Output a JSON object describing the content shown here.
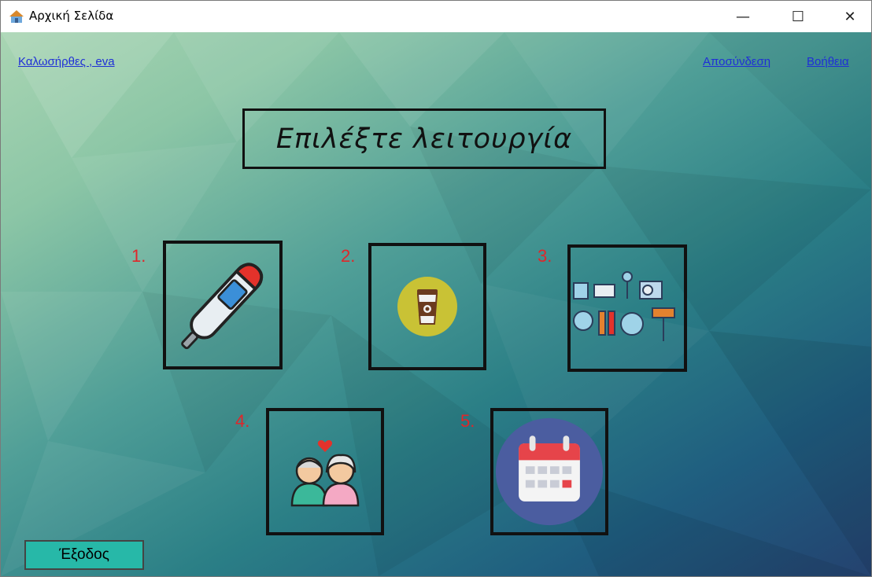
{
  "window": {
    "title": "Αρχική Σελίδα",
    "minimize_glyph": "—",
    "maximize_glyph": "☐",
    "close_glyph": "✕"
  },
  "header": {
    "welcome_link": "Καλωσήρθες , eva",
    "logout_link": "Αποσύνδεση",
    "help_link": "Βοήθεια"
  },
  "main": {
    "heading": "Επιλέξτε λειτουργία",
    "tiles": [
      {
        "number": "1.",
        "icon": "thermometer-icon"
      },
      {
        "number": "2.",
        "icon": "coffee-cup-icon"
      },
      {
        "number": "3.",
        "icon": "home-appliances-icon"
      },
      {
        "number": "4.",
        "icon": "elderly-couple-icon"
      },
      {
        "number": "5.",
        "icon": "calendar-icon"
      }
    ]
  },
  "footer": {
    "exit_label": "Έξοδος"
  },
  "colors": {
    "link": "#1f2fd6",
    "number": "#e0262a",
    "exit_button": "#27b8a8"
  }
}
